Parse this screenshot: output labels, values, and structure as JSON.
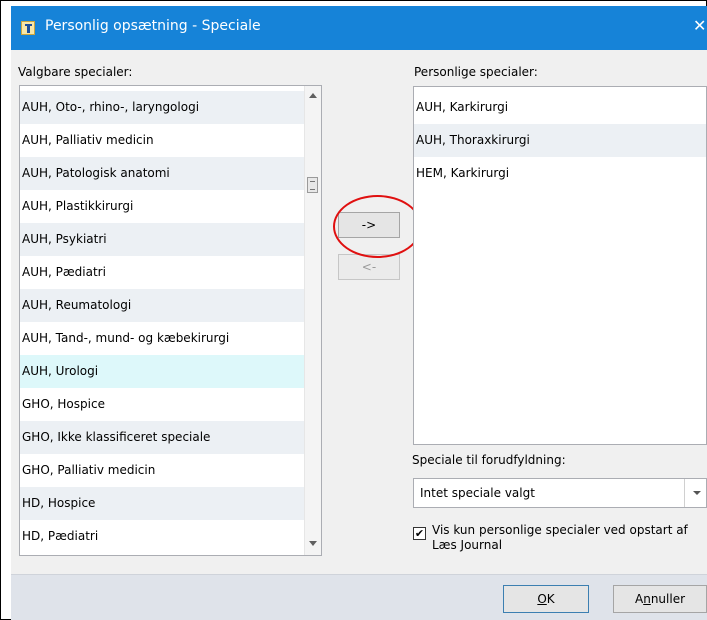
{
  "window": {
    "title": "Personlig opsætning - Speciale",
    "close_glyph": "✕",
    "accent_color": "#1683d8"
  },
  "left": {
    "label": "Valgbare specialer:",
    "items": [
      "AUH, Oto-, rhino-, laryngologi",
      "AUH, Palliativ medicin",
      "AUH, Patologisk anatomi",
      "AUH, Plastikkirurgi",
      "AUH, Psykiatri",
      "AUH, Pædiatri",
      "AUH, Reumatologi",
      "AUH, Tand-, mund- og kæbekirurgi",
      "AUH, Urologi",
      "GHO, Hospice",
      "GHO, Ikke klassificeret speciale",
      "GHO, Palliativ medicin",
      "HD, Hospice",
      "HD, Pædiatri"
    ],
    "selected": "AUH, Urologi"
  },
  "right": {
    "label": "Personlige specialer:",
    "items": [
      "AUH, Karkirurgi",
      "AUH, Thoraxkirurgi",
      "HEM, Karkirurgi"
    ]
  },
  "buttons": {
    "add": "->",
    "remove": "<-",
    "ok_underline": "O",
    "ok_rest": "K",
    "cancel_pre": "A",
    "cancel_underline": "n",
    "cancel_post": "nuller"
  },
  "prefill": {
    "label": "Speciale til forudfyldning:",
    "value": "Intet speciale valgt"
  },
  "option": {
    "checked": true,
    "check_glyph": "✔",
    "label": "Vis kun personlige specialer ved opstart af Læs Journal"
  },
  "annotation_color": "#e01010"
}
